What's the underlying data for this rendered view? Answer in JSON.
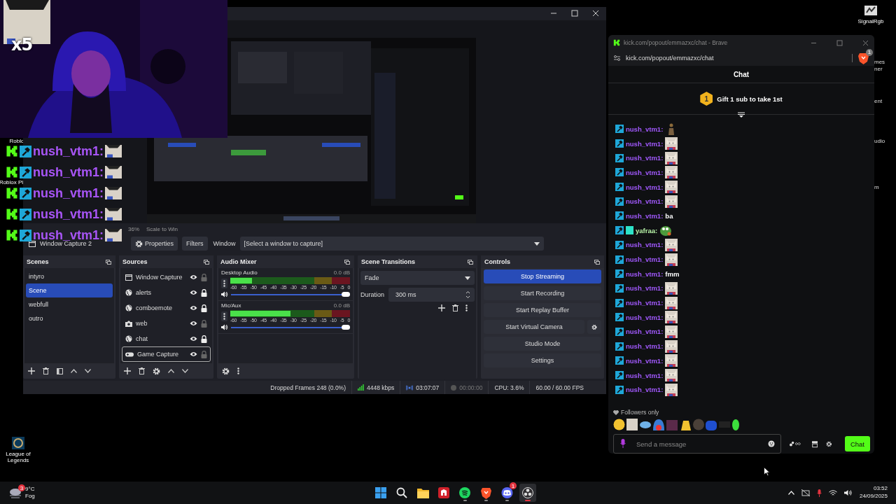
{
  "desktop": {
    "icons": [
      {
        "label": "SignalRgb",
        "kind": "signal"
      },
      {
        "label": "Roblo",
        "kind": "none"
      },
      {
        "label": "Roblox Pl",
        "kind": "none"
      },
      {
        "label": "League of Legends",
        "kind": "league"
      }
    ],
    "edge_labels": [
      "mes",
      "ner",
      "ent",
      "udio",
      "m"
    ]
  },
  "overlay": {
    "multiplier": "x5",
    "chat": [
      {
        "user": "nush_vtm1:"
      },
      {
        "user": "nush_vtm1:"
      },
      {
        "user": "nush_vtm1:"
      },
      {
        "user": "nush_vtm1:"
      },
      {
        "user": "nush_vtm1:"
      }
    ]
  },
  "obs": {
    "preview_zoom": "36%",
    "scale_mode": "Scale to Win",
    "source_name": "Window Capture 2",
    "properties": "Properties",
    "filters": "Filters",
    "window_label": "Window",
    "window_value": "[Select a window to capture]",
    "scenes": {
      "title": "Scenes",
      "items": [
        {
          "name": "intyro",
          "selected": false
        },
        {
          "name": "Scene",
          "selected": true
        },
        {
          "name": "webfull",
          "selected": false
        },
        {
          "name": "outro",
          "selected": false
        }
      ]
    },
    "sources": {
      "title": "Sources",
      "items": [
        {
          "name": "Window Capture",
          "kind": "window",
          "visible": true,
          "locked": false,
          "selected": false
        },
        {
          "name": "alerts",
          "kind": "browser",
          "visible": true,
          "locked": true,
          "selected": false
        },
        {
          "name": "comboemote",
          "kind": "browser",
          "visible": true,
          "locked": true,
          "selected": false
        },
        {
          "name": "web",
          "kind": "camera",
          "visible": true,
          "locked": false,
          "selected": false
        },
        {
          "name": "chat",
          "kind": "browser",
          "visible": true,
          "locked": true,
          "selected": false
        },
        {
          "name": "Game Capture",
          "kind": "game",
          "visible": true,
          "locked": false,
          "selected": true
        }
      ]
    },
    "audio_mixer": {
      "title": "Audio Mixer",
      "channels": [
        {
          "name": "Desktop Audio",
          "reading": "0.0 dB",
          "meter": {
            "level": 0.18
          },
          "volume": {
            "level": 1
          },
          "scale": [
            "-60",
            "-55",
            "-50",
            "-45",
            "-40",
            "-35",
            "-30",
            "-25",
            "-20",
            "-15",
            "-10",
            "-5",
            "0"
          ]
        },
        {
          "name": "Mic/Aux",
          "reading": "0.0 dB",
          "meter": {
            "level": 0.5
          },
          "volume": {
            "level": 1
          },
          "scale": [
            "-60",
            "-55",
            "-50",
            "-45",
            "-40",
            "-35",
            "-30",
            "-25",
            "-20",
            "-15",
            "-10",
            "-5",
            "0"
          ]
        }
      ]
    },
    "transitions": {
      "title": "Scene Transitions",
      "transition": "Fade",
      "duration_label": "Duration",
      "duration": "300 ms"
    },
    "controls": {
      "title": "Controls",
      "buttons": [
        {
          "label": "Stop Streaming",
          "active": true,
          "kind": "plain"
        },
        {
          "label": "Start Recording",
          "active": false,
          "kind": "plain"
        },
        {
          "label": "Start Replay Buffer",
          "active": false,
          "kind": "plain"
        },
        {
          "label": "Start Virtual Camera",
          "active": false,
          "kind": "split"
        },
        {
          "label": "Studio Mode",
          "active": false,
          "kind": "plain"
        },
        {
          "label": "Settings",
          "active": false,
          "kind": "plain"
        }
      ]
    },
    "status": {
      "dropped": "Dropped Frames 248 (0.0%)",
      "bitrate": "4448 kbps",
      "stream_time": "03:07:07",
      "record_time": "00:00:00",
      "cpu": "CPU: 3.6%",
      "fps": "60.00 / 60.00 FPS"
    }
  },
  "chat": {
    "window_title": "kick.com/popout/emmazxc/chat - Brave",
    "url": "kick.com/popout/emmazxc/chat",
    "shield_count": "1",
    "header": "Chat",
    "gift": {
      "rank": "1",
      "text": "Gift 1 sub to take 1st"
    },
    "messages": [
      {
        "user": "nush_vtm1:",
        "color": "#a259ff",
        "og_badge": false,
        "kind": "figure"
      },
      {
        "user": "nush_vtm1:",
        "color": "#a259ff",
        "og_badge": false,
        "kind": "cat"
      },
      {
        "user": "nush_vtm1:",
        "color": "#a259ff",
        "og_badge": false,
        "kind": "cat"
      },
      {
        "user": "nush_vtm1:",
        "color": "#a259ff",
        "og_badge": false,
        "kind": "cat"
      },
      {
        "user": "nush_vtm1:",
        "color": "#a259ff",
        "og_badge": false,
        "kind": "cat"
      },
      {
        "user": "nush_vtm1:",
        "color": "#a259ff",
        "og_badge": false,
        "kind": "cat"
      },
      {
        "user": "nush_vtm1:",
        "color": "#a259ff",
        "og_badge": false,
        "kind": "text",
        "text": "ba"
      },
      {
        "user": "yafraa:",
        "color": "#b8f5a8",
        "og_badge": true,
        "kind": "frog"
      },
      {
        "user": "nush_vtm1:",
        "color": "#a259ff",
        "og_badge": false,
        "kind": "cat"
      },
      {
        "user": "nush_vtm1:",
        "color": "#a259ff",
        "og_badge": false,
        "kind": "cat"
      },
      {
        "user": "nush_vtm1:",
        "color": "#a259ff",
        "og_badge": false,
        "kind": "text",
        "text": "fmm"
      },
      {
        "user": "nush_vtm1:",
        "color": "#a259ff",
        "og_badge": false,
        "kind": "cat"
      },
      {
        "user": "nush_vtm1:",
        "color": "#a259ff",
        "og_badge": false,
        "kind": "cat"
      },
      {
        "user": "nush_vtm1:",
        "color": "#a259ff",
        "og_badge": false,
        "kind": "cat"
      },
      {
        "user": "nush_vtm1:",
        "color": "#a259ff",
        "og_badge": false,
        "kind": "cat"
      },
      {
        "user": "nush_vtm1:",
        "color": "#a259ff",
        "og_badge": false,
        "kind": "cat"
      },
      {
        "user": "nush_vtm1:",
        "color": "#a259ff",
        "og_badge": false,
        "kind": "cat"
      },
      {
        "user": "nush_vtm1:",
        "color": "#a259ff",
        "og_badge": false,
        "kind": "cat"
      },
      {
        "user": "nush_vtm1:",
        "color": "#a259ff",
        "og_badge": false,
        "kind": "cat"
      }
    ],
    "followers_only": "Followers only",
    "input": {
      "placeholder": "Send a message"
    },
    "send": "Chat"
  },
  "taskbar": {
    "weather": {
      "temp": "9°C",
      "condition": "Fog",
      "badge": "3"
    },
    "apps": [
      {
        "kind": "start",
        "running": false,
        "selected": false
      },
      {
        "kind": "search",
        "running": false,
        "selected": false
      },
      {
        "kind": "explorer",
        "running": false,
        "selected": false
      },
      {
        "kind": "red",
        "running": false,
        "selected": false
      },
      {
        "kind": "spotify",
        "running": true,
        "selected": false
      },
      {
        "kind": "brave",
        "running": true,
        "selected": false
      },
      {
        "kind": "discord",
        "running": true,
        "selected": false,
        "badge": "1"
      },
      {
        "kind": "obs",
        "running": true,
        "selected": true
      }
    ],
    "time": "03:52",
    "date": "24/09/2025"
  }
}
